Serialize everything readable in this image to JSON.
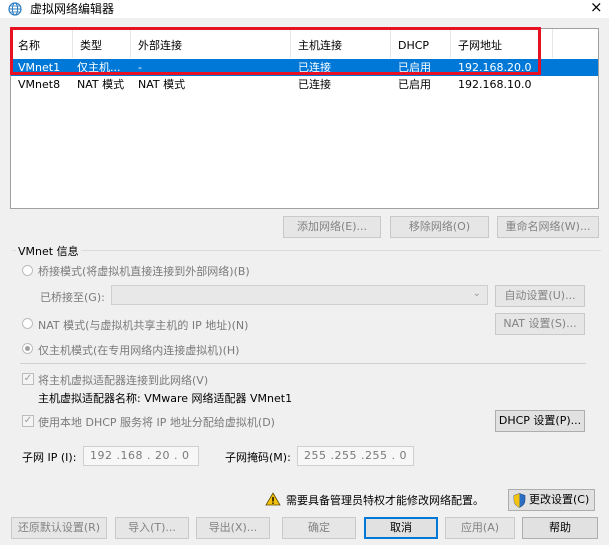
{
  "window": {
    "title": "虚拟网络编辑器",
    "close_glyph": "×"
  },
  "network_list": {
    "columns": [
      "名称",
      "类型",
      "外部连接",
      "主机连接",
      "DHCP",
      "子网地址"
    ],
    "rows": [
      [
        "VMnet1",
        "仅主机...",
        "-",
        "已连接",
        "已启用",
        "192.168.20.0"
      ],
      [
        "VMnet8",
        "NAT 模式",
        "NAT 模式",
        "已连接",
        "已启用",
        "192.168.10.0"
      ]
    ],
    "selected_row": 0
  },
  "list_buttons": {
    "add": "添加网络(E)...",
    "remove": "移除网络(O)",
    "rename": "重命名网络(W)..."
  },
  "vmnet_info": {
    "group_label": "VMnet 信息",
    "bridge_mode": "桥接模式(将虚拟机直接连接到外部网络)(B)",
    "bridged_to_label": "已桥接至(G):",
    "bridged_to_value": "",
    "auto_settings": "自动设置(U)...",
    "nat_mode": "NAT 模式(与虚拟机共享主机的 IP 地址)(N)",
    "nat_settings": "NAT 设置(S)...",
    "host_only_mode": "仅主机模式(在专用网络内连接虚拟机)(H)",
    "selected_mode": "host_only",
    "connect_adapter": "将主机虚拟适配器连接到此网络(V)",
    "connect_adapter_checked": true,
    "adapter_name": "主机虚拟适配器名称: VMware 网络适配器 VMnet1",
    "use_dhcp": "使用本地 DHCP 服务将 IP 地址分配给虚拟机(D)",
    "use_dhcp_checked": true,
    "dhcp_settings": "DHCP 设置(P)...",
    "subnet_ip_label": "子网 IP (I):",
    "subnet_ip_value": "192 .168 . 20 . 0",
    "subnet_mask_label": "子网掩码(M):",
    "subnet_mask_value": "255 .255 .255 . 0"
  },
  "admin_notice": {
    "text": "需要具备管理员特权才能修改网络配置。",
    "change_settings": "更改设置(C)"
  },
  "footer_buttons": {
    "restore_defaults": "还原默认设置(R)",
    "import": "导入(T)...",
    "export": "导出(X)...",
    "ok": "确定",
    "cancel": "取消",
    "apply": "应用(A)",
    "help": "帮助"
  },
  "colors": {
    "selection": "#0078d7",
    "highlight_box": "#e81123",
    "warning": "#f4c20d"
  }
}
